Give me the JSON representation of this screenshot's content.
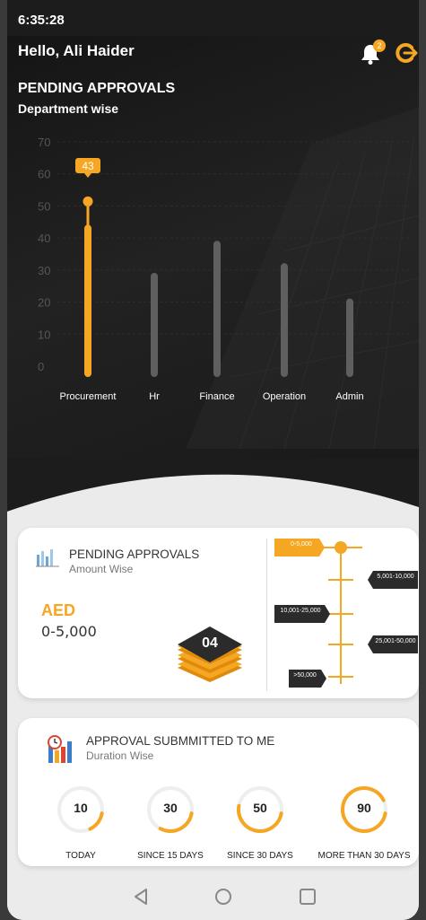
{
  "status_bar": {
    "time": "6:35:28"
  },
  "header": {
    "greeting": "Hello, Ali Haider",
    "notification_count": "2",
    "title": "PENDING APPROVALS",
    "subtitle": "Department wise"
  },
  "chart_data": {
    "type": "bar",
    "categories": [
      "Procurement",
      "Hr",
      "Finance",
      "Operation",
      "Admin"
    ],
    "values": [
      43,
      28,
      38,
      31,
      20
    ],
    "highlighted_index": 0,
    "highlight_label": "43",
    "ylim": [
      0,
      70
    ],
    "yticks": [
      "0",
      "10",
      "20",
      "30",
      "40",
      "50",
      "60",
      "70"
    ],
    "grid": true,
    "colors": {
      "highlight": "#f5a623",
      "bar": "#5f5f5f",
      "label": "#ffffff",
      "tick": "#555555"
    }
  },
  "amount_card": {
    "title": "PENDING APPROVALS",
    "subtitle": "Amount Wise",
    "currency": "AED",
    "selected_range": "0-5,000",
    "count": "04",
    "ranges": [
      "0-5,000",
      "5,001-10,000",
      "10,001-25,000",
      "25,001-50,000",
      ">50,000"
    ],
    "active_range_index": 0
  },
  "duration_card": {
    "title": "APPROVAL SUBMMITTED TO ME",
    "subtitle": "Duration Wise",
    "items": [
      {
        "value": "10",
        "label": "TODAY",
        "progress": 0.15
      },
      {
        "value": "30",
        "label": "SINCE 15 DAYS",
        "progress": 0.3
      },
      {
        "value": "50",
        "label": "SINCE 30 DAYS",
        "progress": 0.5
      },
      {
        "value": "90",
        "label": "MORE THAN 30 DAYS",
        "progress": 0.9
      }
    ]
  },
  "accent_color": "#f5a623"
}
